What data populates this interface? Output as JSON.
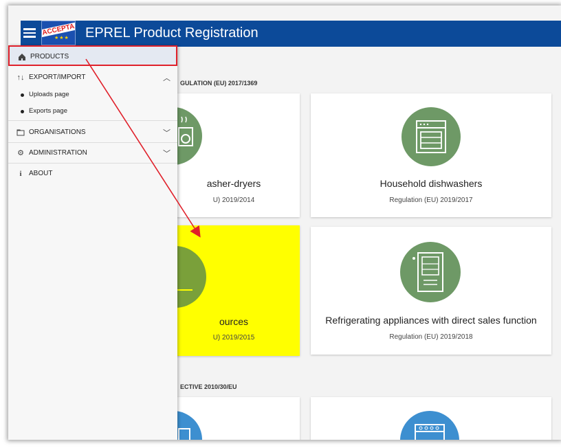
{
  "header": {
    "app_title": "EPREL Product Registration",
    "logo_text": "ACCEPTA...",
    "menu_icon": "hamburger-icon",
    "brand_color": "#0c4a99"
  },
  "sidebar": {
    "items": [
      {
        "label": "PRODUCTS",
        "icon": "home-icon",
        "active": true
      },
      {
        "label": "EXPORT/IMPORT",
        "icon": "transfer-icon",
        "expanded": true,
        "children": [
          {
            "label": "Uploads page"
          },
          {
            "label": "Exports page"
          }
        ]
      },
      {
        "label": "ORGANISATIONS",
        "icon": "folder-icon",
        "expanded": false
      },
      {
        "label": "ADMINISTRATION",
        "icon": "gear-icon",
        "expanded": false
      },
      {
        "label": "ABOUT",
        "icon": "info-icon"
      }
    ]
  },
  "main": {
    "section1_heading": "GULATION (EU) 2017/1369",
    "section2_heading": "ECTIVE 2010/30/EU",
    "cards": [
      {
        "title": "asher-dryers",
        "regulation": "U) 2019/2014",
        "icon": "washer-dryer-icon"
      },
      {
        "title": "Household dishwashers",
        "regulation": "Regulation (EU) 2019/2017",
        "icon": "dishwasher-icon"
      },
      {
        "title": "ources",
        "regulation": "U) 2019/2015",
        "icon": "light-source-icon",
        "highlighted": true
      },
      {
        "title": "Refrigerating appliances with direct sales function",
        "regulation": "Regulation (EU) 2019/2018",
        "icon": "refrigerator-icon"
      },
      {
        "title": "",
        "regulation": "",
        "icon": "appliance-icon"
      },
      {
        "title": "",
        "regulation": "",
        "icon": "oven-icon"
      }
    ]
  },
  "annotation": {
    "color": "#e0202a",
    "highlight_color": "#ffff00"
  }
}
